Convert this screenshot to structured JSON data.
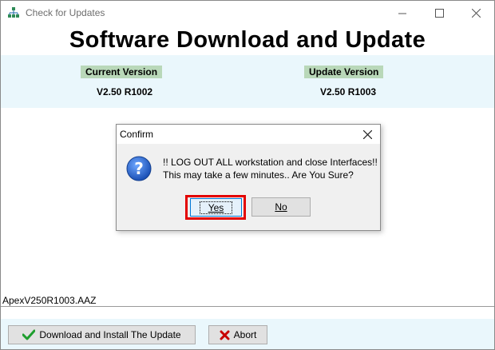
{
  "window": {
    "title": "Check for Updates",
    "banner_title": "Software Download and Update"
  },
  "versions": {
    "current_label": "Current Version",
    "current_value": "V2.50 R1002",
    "update_label": "Update Version",
    "update_value": "V2.50 R1003"
  },
  "file": {
    "name": "ApexV250R1003.AAZ"
  },
  "actions": {
    "download_label": "Download and Install The Update",
    "abort_label": "Abort"
  },
  "dialog": {
    "title": "Confirm",
    "message_line1": "!! LOG OUT ALL workstation and close Interfaces!!",
    "message_line2": "This may take a few minutes.. Are You Sure?",
    "yes_label": "Yes",
    "no_label": "No",
    "highlight_color": "#e30000"
  },
  "icons": {
    "app": "network-tree-icon",
    "question": "question-icon",
    "check": "green-check-icon",
    "abort": "red-x-icon"
  }
}
